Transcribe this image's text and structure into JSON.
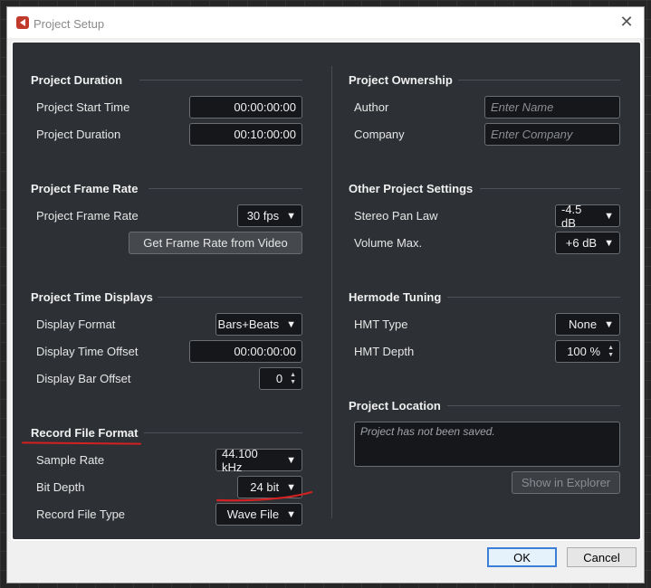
{
  "window": {
    "title": "Project Setup",
    "close_glyph": "✕"
  },
  "left": {
    "duration": {
      "title": "Project Duration",
      "start_label": "Project Start Time",
      "start_value": "00:00:00:00",
      "duration_label": "Project Duration",
      "duration_value": "00:10:00:00"
    },
    "frame_rate": {
      "title": "Project Frame Rate",
      "rate_label": "Project Frame Rate",
      "rate_value": "30 fps",
      "video_button": "Get Frame Rate from Video"
    },
    "time_displays": {
      "title": "Project Time Displays",
      "format_label": "Display Format",
      "format_value": "Bars+Beats",
      "offset_label": "Display Time Offset",
      "offset_value": "00:00:00:00",
      "bar_offset_label": "Display Bar Offset",
      "bar_offset_value": "0"
    },
    "record_format": {
      "title": "Record File Format",
      "sample_rate_label": "Sample Rate",
      "sample_rate_value": "44.100 kHz",
      "bit_depth_label": "Bit Depth",
      "bit_depth_value": "24 bit",
      "file_type_label": "Record File Type",
      "file_type_value": "Wave File"
    }
  },
  "right": {
    "ownership": {
      "title": "Project Ownership",
      "author_label": "Author",
      "author_placeholder": "Enter Name",
      "company_label": "Company",
      "company_placeholder": "Enter Company"
    },
    "other": {
      "title": "Other Project Settings",
      "pan_law_label": "Stereo Pan Law",
      "pan_law_value": "-4.5 dB",
      "volume_label": "Volume Max.",
      "volume_value": "+6 dB"
    },
    "hermode": {
      "title": "Hermode Tuning",
      "type_label": "HMT Type",
      "type_value": "None",
      "depth_label": "HMT Depth",
      "depth_value": "100 %"
    },
    "location": {
      "title": "Project Location",
      "path_text": "Project has not been saved.",
      "explorer_button": "Show in Explorer"
    }
  },
  "footer": {
    "ok_label": "OK",
    "cancel_label": "Cancel"
  },
  "icons": {
    "dropdown": "▼",
    "spin_up": "▲",
    "spin_down": "▼"
  },
  "colors": {
    "panel_bg": "#2d3035",
    "annotation_red": "#d32020",
    "ok_border": "#3c7fd8"
  }
}
